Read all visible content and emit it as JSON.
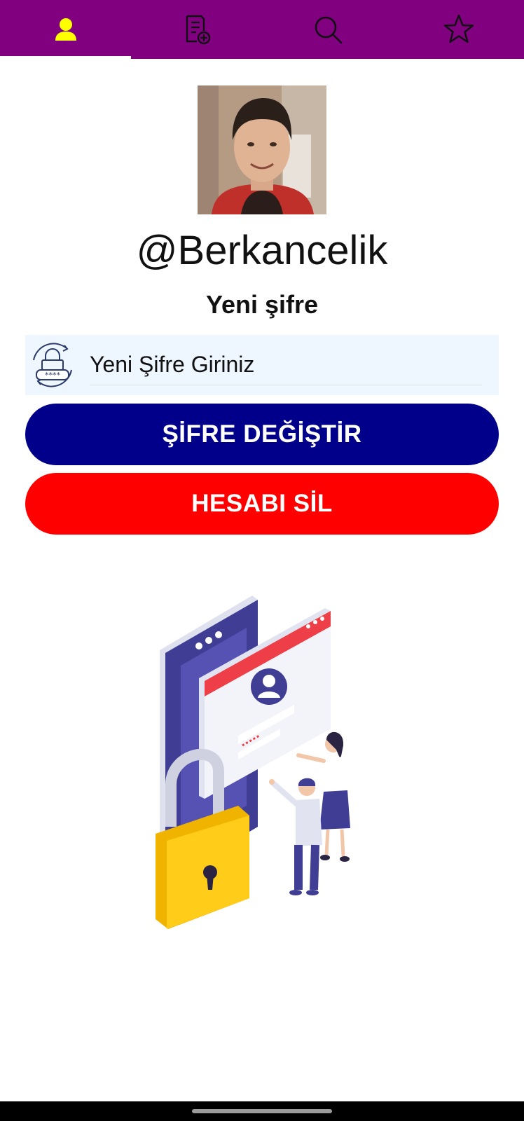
{
  "tabs": [
    {
      "name": "profile",
      "icon": "user-icon",
      "active": true
    },
    {
      "name": "add-post",
      "icon": "document-add-icon",
      "active": false
    },
    {
      "name": "search",
      "icon": "search-icon",
      "active": false
    },
    {
      "name": "favorites",
      "icon": "star-icon",
      "active": false
    }
  ],
  "profile": {
    "username": "@Berkancelik",
    "section_title": "Yeni şifre"
  },
  "password": {
    "placeholder": "Yeni Şifre Giriniz",
    "value": ""
  },
  "buttons": {
    "change_password": "ŞİFRE DEĞİŞTİR",
    "delete_account": "HESABI SİL"
  },
  "colors": {
    "tabbar": "#800080",
    "active_icon": "#ffff00",
    "change_button": "#00008b",
    "delete_button": "#ff0000",
    "input_background": "#eef6ff"
  }
}
